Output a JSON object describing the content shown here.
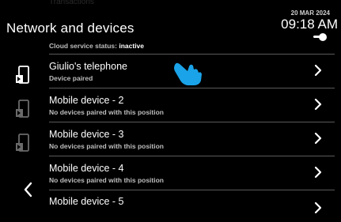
{
  "header": {
    "ghost_text": "Transactions",
    "title": "Network and devices",
    "status_label": "Cloud service status:",
    "status_value": "inactive",
    "date": "20 MAR 2024",
    "time": "09:18 AM"
  },
  "devices": [
    {
      "label": "Giulio's telephone",
      "sub": "Device paired",
      "icon": "phone-icon",
      "active": true
    },
    {
      "label": "Mobile device - 2",
      "sub": "No devices paired with this position",
      "icon": "phone-icon",
      "active": false
    },
    {
      "label": "Mobile device - 3",
      "sub": "No devices paired with this position",
      "icon": "phone-icon",
      "active": false
    },
    {
      "label": "Mobile device - 4",
      "sub": "No devices paired with this position",
      "icon": "phone-icon",
      "active": false
    },
    {
      "label": "Mobile device - 5",
      "sub": "",
      "icon": "phone-icon",
      "active": false
    }
  ],
  "colors": {
    "accent": "#1aa3e8",
    "background": "#000000",
    "separator": "#5a5a5a"
  }
}
